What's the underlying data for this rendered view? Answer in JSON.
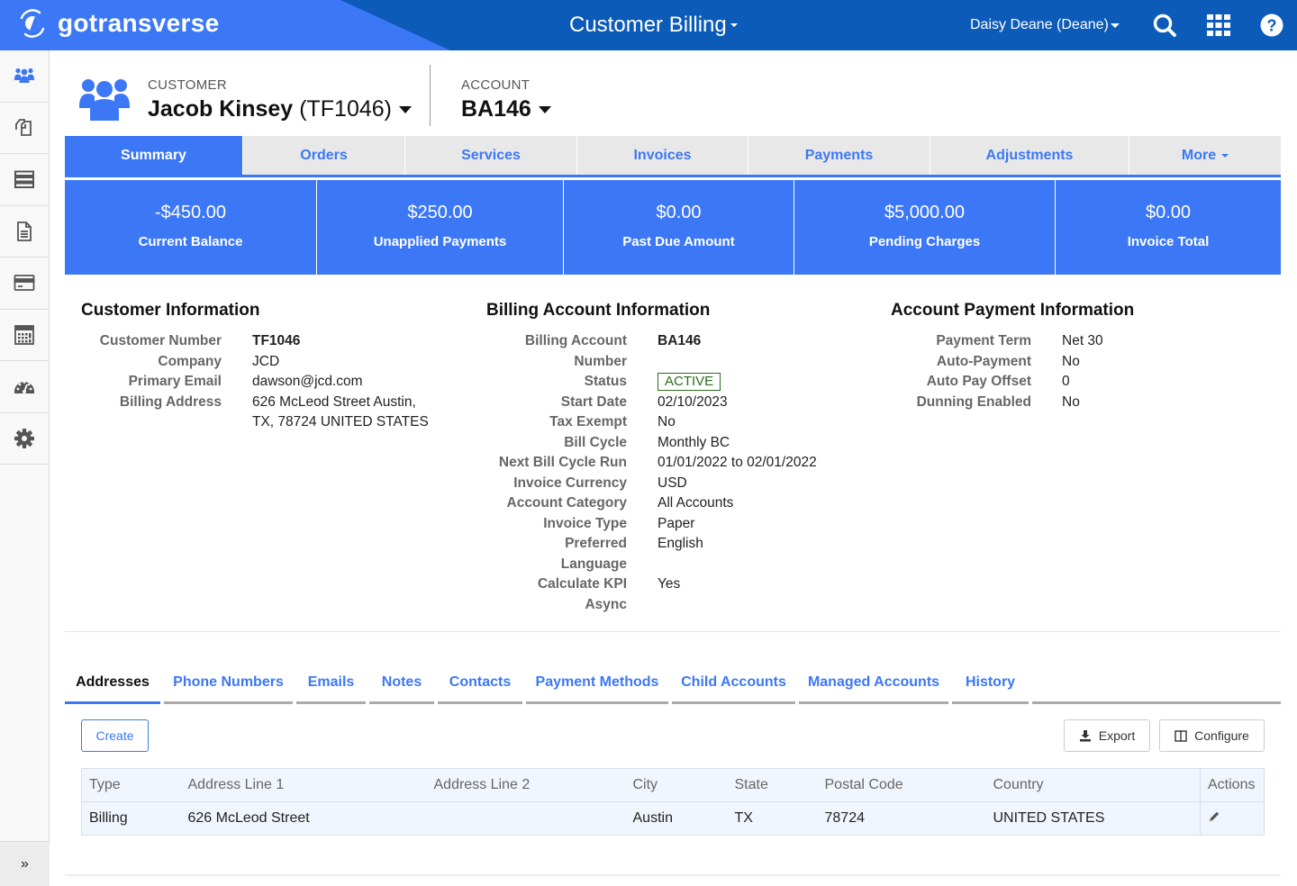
{
  "topbar": {
    "brand": "gotransverse",
    "app_title": "Customer Billing",
    "user": "Daisy Deane (Deane)",
    "icons": [
      "search-icon",
      "apps-grid-icon",
      "help-icon"
    ],
    "colors": {
      "bar": "#0d5bb8",
      "brand_bg": "#3c78f5"
    }
  },
  "sidebar": {
    "items": [
      {
        "icon": "customers-icon",
        "active": true
      },
      {
        "icon": "catalog-icon",
        "active": false
      },
      {
        "icon": "server-list-icon",
        "active": false
      },
      {
        "icon": "document-icon",
        "active": false
      },
      {
        "icon": "credit-card-icon",
        "active": false
      },
      {
        "icon": "calculator-icon",
        "active": false
      },
      {
        "icon": "dashboard-icon",
        "active": false
      },
      {
        "icon": "gear-icon",
        "active": false
      }
    ],
    "expand_label": "»"
  },
  "header": {
    "customer_label": "CUSTOMER",
    "customer_name": "Jacob Kinsey",
    "customer_id": "(TF1046)",
    "account_label": "ACCOUNT",
    "account_id": "BA146"
  },
  "tabs": [
    {
      "label": "Summary",
      "active": true
    },
    {
      "label": "Orders",
      "active": false
    },
    {
      "label": "Services",
      "active": false
    },
    {
      "label": "Invoices",
      "active": false
    },
    {
      "label": "Payments",
      "active": false
    },
    {
      "label": "Adjustments",
      "active": false
    },
    {
      "label": "More",
      "active": false,
      "dropdown": true
    }
  ],
  "kpis": [
    {
      "value": "-$450.00",
      "label": "Current Balance"
    },
    {
      "value": "$250.00",
      "label": "Unapplied Payments"
    },
    {
      "value": "$0.00",
      "label": "Past Due Amount"
    },
    {
      "value": "$5,000.00",
      "label": "Pending Charges"
    },
    {
      "value": "$0.00",
      "label": "Invoice Total"
    }
  ],
  "customer_info": {
    "title": "Customer Information",
    "rows": [
      {
        "label": "Customer Number",
        "value": "TF1046"
      },
      {
        "label": "Company",
        "value": "JCD"
      },
      {
        "label": "Primary Email",
        "value": "dawson@jcd.com"
      },
      {
        "label": "Billing Address",
        "value": "626 McLeod Street Austin,",
        "value2": "TX, 78724 UNITED STATES"
      }
    ]
  },
  "billing_info": {
    "title": "Billing Account Information",
    "rows": [
      {
        "label": "Billing Account",
        "label2": "Number",
        "value": "BA146"
      },
      {
        "label": "Status",
        "value": "ACTIVE"
      },
      {
        "label": "Start Date",
        "value": "02/10/2023"
      },
      {
        "label": "Tax Exempt",
        "value": "No"
      },
      {
        "label": "Bill Cycle",
        "value": "Monthly BC"
      },
      {
        "label": "Next Bill Cycle Run",
        "value": "01/01/2022 to 02/01/2022"
      },
      {
        "label": "Invoice Currency",
        "value": "USD"
      },
      {
        "label": "Account Category",
        "value": "All Accounts"
      },
      {
        "label": "Invoice Type",
        "value": "Paper"
      },
      {
        "label": "Preferred",
        "label2": "Language",
        "value": "English"
      },
      {
        "label": "Calculate KPI",
        "label2": "Async",
        "value": "Yes"
      }
    ]
  },
  "payment_info": {
    "title": "Account Payment Information",
    "rows": [
      {
        "label": "Payment Term",
        "value": "Net 30"
      },
      {
        "label": "Auto-Payment",
        "value": "No"
      },
      {
        "label": "Auto Pay Offset",
        "value": "0"
      },
      {
        "label": "Dunning Enabled",
        "value": "No"
      }
    ]
  },
  "subtabs": [
    {
      "label": "Addresses",
      "active": true
    },
    {
      "label": "Phone Numbers",
      "active": false
    },
    {
      "label": "Emails",
      "active": false
    },
    {
      "label": "Notes",
      "active": false
    },
    {
      "label": "Contacts",
      "active": false
    },
    {
      "label": "Payment Methods",
      "active": false
    },
    {
      "label": "Child Accounts",
      "active": false
    },
    {
      "label": "Managed Accounts",
      "active": false
    },
    {
      "label": "History",
      "active": false
    }
  ],
  "toolbar": {
    "create_label": "Create",
    "export_label": "Export",
    "configure_label": "Configure"
  },
  "addresses_table": {
    "columns": [
      "Type",
      "Address Line 1",
      "Address Line 2",
      "City",
      "State",
      "Postal Code",
      "Country",
      "Actions"
    ],
    "rows": [
      {
        "type": "Billing",
        "line1": "626 McLeod Street",
        "line2": "",
        "city": "Austin",
        "state": "TX",
        "postal": "78724",
        "country": "UNITED STATES",
        "action_icon": "edit-pencil-icon"
      }
    ]
  }
}
